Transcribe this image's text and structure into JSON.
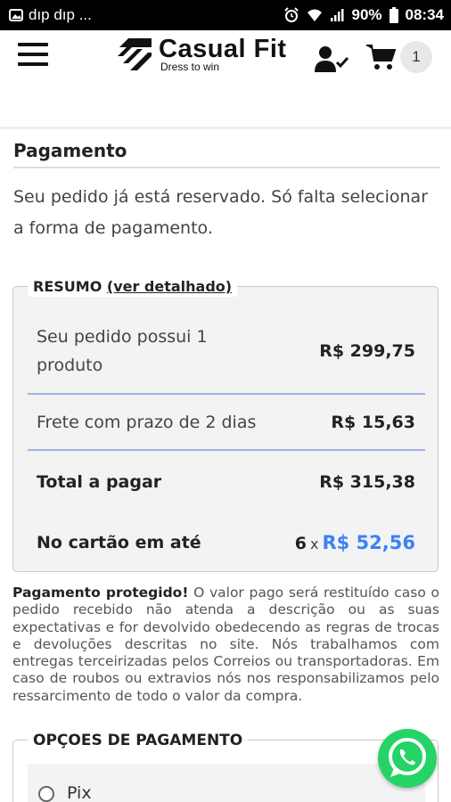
{
  "status_bar": {
    "left_text": "dıp dıp ...",
    "battery": "90%",
    "time": "08:34"
  },
  "header": {
    "brand_name": "Casual Fit",
    "brand_tagline": "Dress to win",
    "cart_count": "1",
    "icons": [
      "menu-icon",
      "user-check-icon",
      "cart-icon"
    ]
  },
  "page": {
    "title": "Pagamento",
    "intro": "Seu pedido já está reservado. Só falta selecionar a forma de pagamento."
  },
  "summary": {
    "legend": "RESUMO",
    "details_link": "(ver detalhado)",
    "rows": [
      {
        "label": "Seu pedido possui 1 produto",
        "value": "R$ 299,75"
      },
      {
        "label": "Frete com prazo de 2 dias",
        "value": "R$ 15,63"
      },
      {
        "label": "Total a pagar",
        "value": "R$ 315,38"
      }
    ],
    "installments": {
      "label": "No cartão em até",
      "count": "6",
      "times": "x",
      "amount": "R$ 52,56"
    }
  },
  "protection": {
    "bold": "Pagamento protegido!",
    "text": " O valor pago será restituído caso o pedido recebido não atenda a descrição ou as suas expectativas e for devolvido obedecendo as regras de trocas e devoluções descritas no site. Nós trabalhamos com entregas terceirizadas pelos Correios ou transportadoras. Em caso de roubos ou extravios nós nos responsabilizamos pelo ressarcimento de todo o valor da compra."
  },
  "payment_options": {
    "legend": "OPÇOES DE PAGAMENTO",
    "options": [
      {
        "label": "Pix",
        "selected": false
      }
    ]
  },
  "colors": {
    "accent_blue": "#3b82f6",
    "divider_blue": "#9fb3e6",
    "whatsapp_green": "#25d366"
  }
}
